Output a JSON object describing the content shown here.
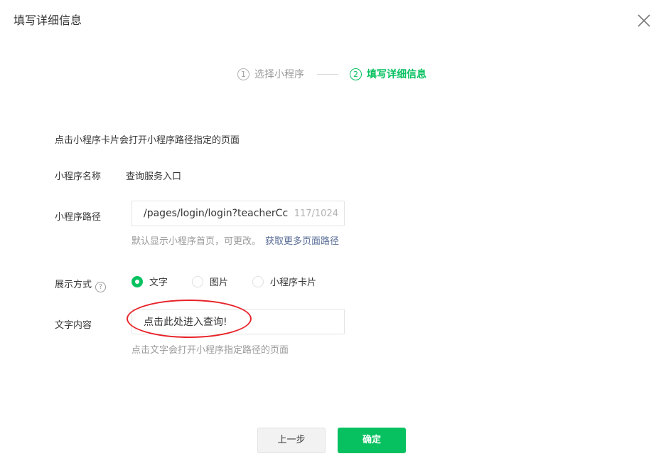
{
  "dialog": {
    "title": "填写详细信息",
    "close_icon": "close-icon"
  },
  "steps": [
    {
      "number": "1",
      "label": "选择小程序",
      "active": false
    },
    {
      "number": "2",
      "label": "填写详细信息",
      "active": true
    }
  ],
  "form": {
    "description": "点击小程序卡片会打开小程序路径指定的页面",
    "name_label": "小程序名称",
    "name_value": "查询服务入口",
    "path_label": "小程序路径",
    "path_value": "/pages/login/login?teacherCc",
    "path_counter": "117/1024",
    "path_hint": "默认显示小程序首页，可更改。",
    "path_hint_link": "获取更多页面路径",
    "display_label": "展示方式",
    "display_help_icon": "question-circle-icon",
    "display_options": [
      {
        "label": "文字",
        "checked": true
      },
      {
        "label": "图片",
        "checked": false
      },
      {
        "label": "小程序卡片",
        "checked": false
      }
    ],
    "text_label": "文字内容",
    "text_value": "点击此处进入查询!",
    "text_hint": "点击文字会打开小程序指定路径的页面"
  },
  "footer": {
    "prev_label": "上一步",
    "ok_label": "确定"
  },
  "colors": {
    "accent": "#07c160",
    "link": "#576b95",
    "annotation": "#e8242a"
  }
}
